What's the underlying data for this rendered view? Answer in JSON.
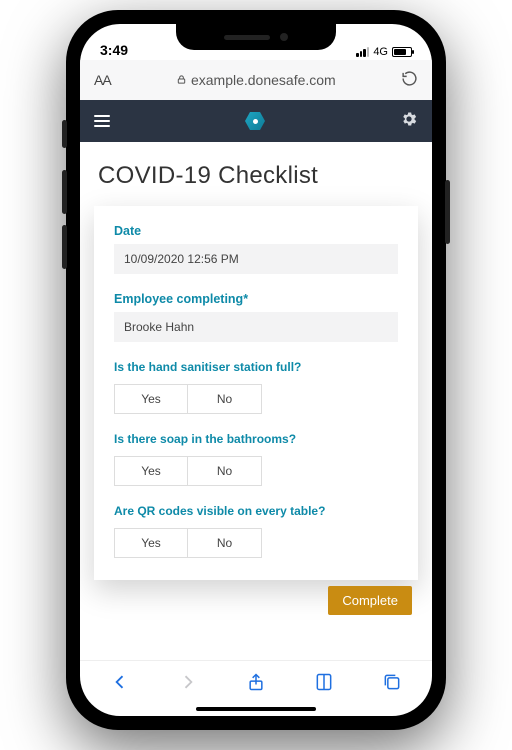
{
  "status": {
    "time": "3:49",
    "network_label": "4G"
  },
  "browser": {
    "aa": "AA",
    "url": "example.donesafe.com"
  },
  "page": {
    "title": "COVID-19 Checklist",
    "complete_label": "Complete"
  },
  "fields": {
    "date": {
      "label": "Date",
      "value": "10/09/2020  12:56 PM"
    },
    "employee": {
      "label": "Employee completing",
      "required_mark": "*",
      "value": "Brooke Hahn"
    }
  },
  "questions": {
    "q1": {
      "text": "Is the hand sanitiser station full?",
      "yes": "Yes",
      "no": "No"
    },
    "q2": {
      "text": "Is there soap in the bathrooms?",
      "yes": "Yes",
      "no": "No"
    },
    "q3": {
      "text": "Are QR codes visible on every table?",
      "yes": "Yes",
      "no": "No"
    }
  }
}
